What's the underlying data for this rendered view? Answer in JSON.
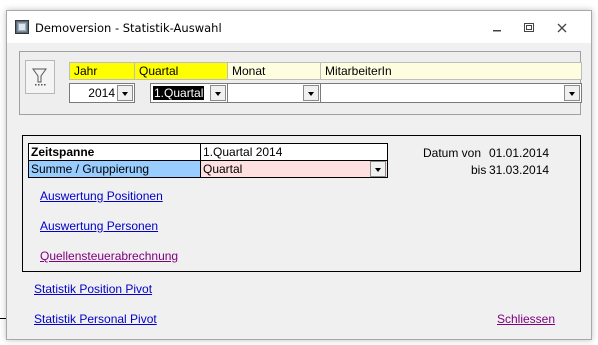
{
  "window": {
    "title": "Demoversion - Statistik-Auswahl"
  },
  "icons": {
    "app": "app-icon",
    "minimize": "minimize-icon",
    "maximize": "maximize-icon",
    "close": "close-icon",
    "filter": "filter-icon"
  },
  "filters": {
    "headers": {
      "jahr": "Jahr",
      "quartal": "Quartal",
      "monat": "Monat",
      "mitarbeiter": "MitarbeiterIn"
    },
    "values": {
      "jahr": "2014",
      "quartal": "1.Quartal",
      "monat": "",
      "mitarbeiter": ""
    }
  },
  "summary": {
    "zeitspanne_label": "Zeitspanne",
    "zeitspanne_value": "1.Quartal 2014",
    "summe_label": "Summe / Gruppierung",
    "summe_value": "Quartal",
    "datum_von_label": "Datum von",
    "datum_von_value": "01.01.2014",
    "bis_label": "bis",
    "bis_value": "31.03.2014"
  },
  "links": {
    "auswertung_positionen": "Auswertung Positionen",
    "auswertung_personen": "Auswertung Personen",
    "quellensteuer": "Quellensteuerabrechnung",
    "pivot_position": "Statistik Position Pivot",
    "pivot_personal": "Statistik Personal Pivot",
    "schliessen": "Schliessen"
  },
  "colors": {
    "header_highlight": "#ffff00",
    "header_normal": "#fffde0",
    "gruppierung_label_bg": "#99ccff",
    "gruppierung_value_bg": "#ffe0e0",
    "link_blue": "#0000cc",
    "link_purple": "#800080"
  }
}
